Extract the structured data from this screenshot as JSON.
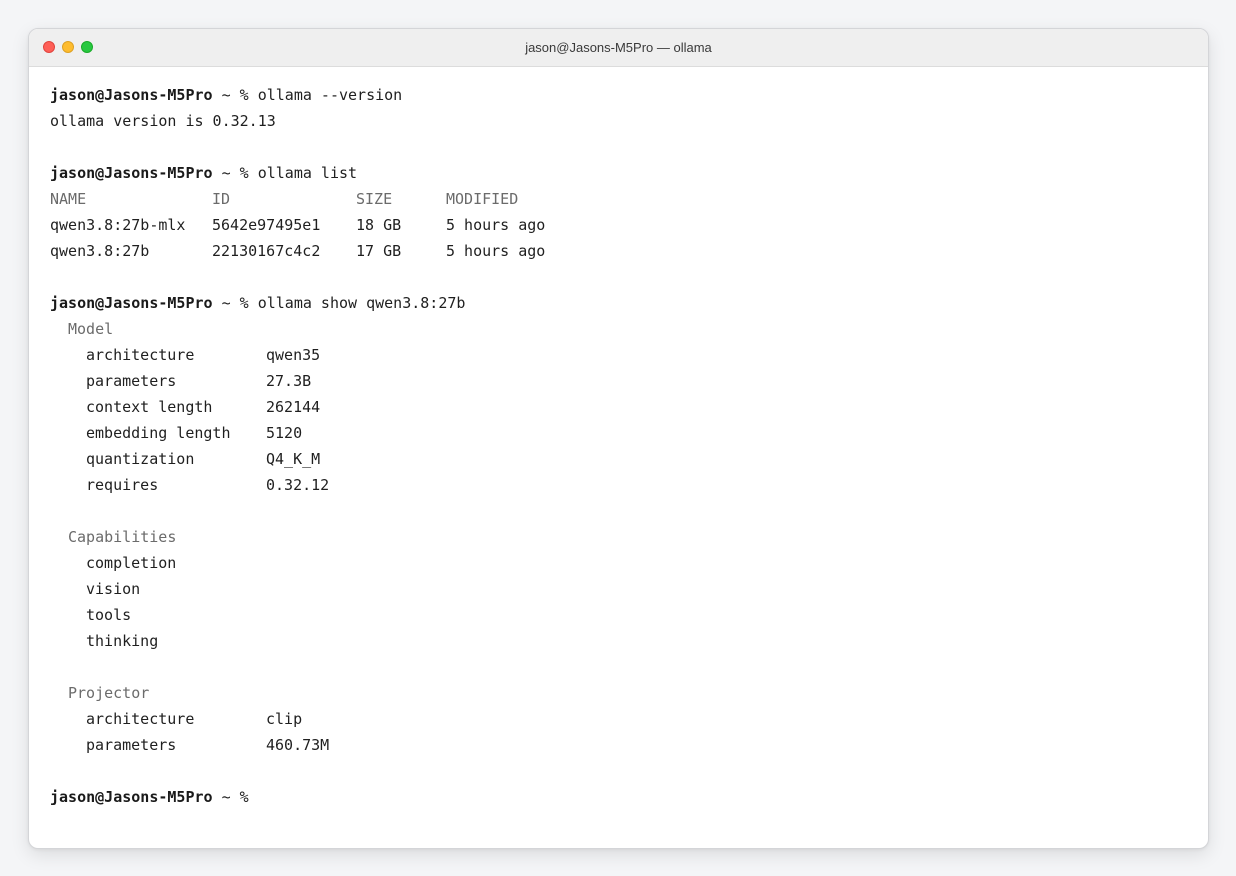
{
  "window": {
    "title": "jason@Jasons-M5Pro — ollama",
    "controls": {
      "close": "close",
      "minimize": "minimize",
      "maximize": "maximize"
    }
  },
  "terminal": {
    "prompt": "jason@Jasons-M5Pro",
    "prompt_suffix": " ~ % ",
    "cmd_version": "ollama --version",
    "version_output": "ollama version is 0.32.13",
    "cmd_list": "ollama list",
    "list_headers": [
      "NAME",
      "ID",
      "SIZE",
      "MODIFIED"
    ],
    "list_rows": [
      [
        "qwen3.8:27b-mlx",
        "5642e97495e1",
        "18 GB",
        "5 hours ago"
      ],
      [
        "qwen3.8:27b",
        "22130167c4c2",
        "17 GB",
        "5 hours ago"
      ]
    ],
    "cmd_show": "ollama show qwen3.8:27b",
    "model_section": "Model",
    "model_props": [
      [
        "architecture",
        "qwen35"
      ],
      [
        "parameters",
        "27.3B"
      ],
      [
        "context length",
        "262144"
      ],
      [
        "embedding length",
        "5120"
      ],
      [
        "quantization",
        "Q4_K_M"
      ],
      [
        "requires",
        "0.32.12"
      ]
    ],
    "capabilities_section": "Capabilities",
    "capabilities": [
      "completion",
      "vision",
      "tools",
      "thinking"
    ],
    "projector_section": "Projector",
    "projector_props": [
      [
        "architecture",
        "clip"
      ],
      [
        "parameters",
        "460.73M"
      ]
    ],
    "final_prompt_suffix": " ~ %"
  }
}
